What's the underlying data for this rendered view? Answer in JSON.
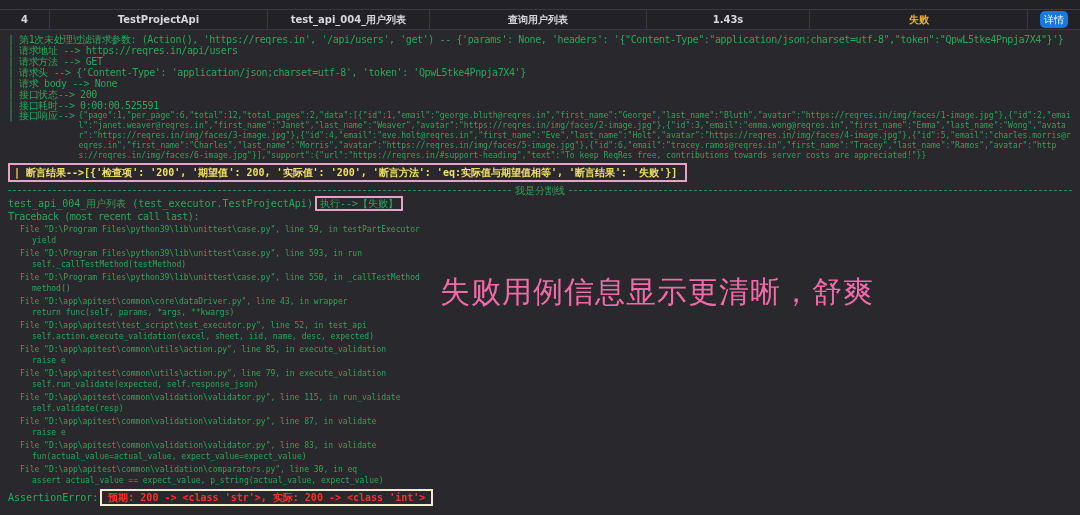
{
  "table": {
    "rows": [
      {
        "index": "4",
        "project": "TestProjectApi",
        "case": "test_api_004_用户列表",
        "description": "查询用户列表",
        "duration": "1.43s",
        "result": "失败",
        "color": "#f5b323",
        "action": "详情"
      }
    ]
  },
  "log": {
    "request_lines": [
      "| 第1次未处理过滤请求参数: (Action(), 'https://reqres.in', '/api/users', 'get') -- {'params': None, 'headers': '{\"Content-Type\":\"application/json;charset=utf-8\",\"token\":\"QpwL5tke4Pnpja7X4\"}'}",
      "| 请求地址 --> https://reqres.in/api/users",
      "| 请求方法 --> GET",
      "| 请求头 --> {'Content-Type': 'application/json;charset=utf-8', 'token': 'QpwL5tke4Pnpja7X4'}",
      "| 请求 body --> None",
      "| 接口状态--> 200",
      "| 接口耗时--> 0:00:00.525591"
    ],
    "response_label": "| 接口响应-->",
    "response_body": "{\"page\":1,\"per_page\":6,\"total\":12,\"total_pages\":2,\"data\":[{\"id\":1,\"email\":\"george.bluth@reqres.in\",\"first_name\":\"George\",\"last_name\":\"Bluth\",\"avatar\":\"https://reqres.in/img/faces/1-image.jpg\"},{\"id\":2,\"email\":\"janet.weaver@reqres.in\",\"first_name\":\"Janet\",\"last_name\":\"Weaver\",\"avatar\":\"https://reqres.in/img/faces/2-image.jpg\"},{\"id\":3,\"email\":\"emma.wong@reqres.in\",\"first_name\":\"Emma\",\"last_name\":\"Wong\",\"avatar\":\"https://reqres.in/img/faces/3-image.jpg\"},{\"id\":4,\"email\":\"eve.holt@reqres.in\",\"first_name\":\"Eve\",\"last_name\":\"Holt\",\"avatar\":\"https://reqres.in/img/faces/4-image.jpg\"},{\"id\":5,\"email\":\"charles.morris@reqres.in\",\"first_name\":\"Charles\",\"last_name\":\"Morris\",\"avatar\":\"https://reqres.in/img/faces/5-image.jpg\"},{\"id\":6,\"email\":\"tracey.ramos@reqres.in\",\"first_name\":\"Tracey\",\"last_name\":\"Ramos\",\"avatar\":\"https://reqres.in/img/faces/6-image.jpg\"}],\"support\":{\"url\":\"https://reqres.in/#support-heading\",\"text\":\"To keep ReqRes free, contributions towards server costs are appreciated!\"}}",
    "assertion_result": "| 断言结果-->[{'检查项': '200', '期望值': 200, '实际值': '200', '断言方法': 'eq:实际值与期望值相等', '断言结果': '失败'}]",
    "separator": "我是分割线",
    "test_name": "test_api_004_用户列表 (test_executor.TestProjectApi)",
    "test_status": "执行-->【失败】",
    "traceback_header": "Traceback (most recent call last):",
    "frames": [
      {
        "location": "File \"D:\\Program Files\\python39\\lib\\unittest\\case.py\", line 59, in testPartExecutor",
        "code": "yield"
      },
      {
        "location": "File \"D:\\Program Files\\python39\\lib\\unittest\\case.py\", line 593, in run",
        "code": "self._callTestMethod(testMethod)"
      },
      {
        "location": "File \"D:\\Program Files\\python39\\lib\\unittest\\case.py\", line 550, in _callTestMethod",
        "code": "method()"
      },
      {
        "location": "File \"D:\\app\\apitest\\common\\core\\dataDriver.py\", line 43, in wrapper",
        "code": "return func(self, params, *args, **kwargs)"
      },
      {
        "location": "File \"D:\\app\\apitest\\test_script\\test_executor.py\", line 52, in test_api",
        "code": "self.action.execute_validation(excel, sheet, iid, name, desc, expected)"
      },
      {
        "location": "File \"D:\\app\\apitest\\common\\utils\\action.py\", line 85, in execute_validation",
        "code": "raise e"
      },
      {
        "location": "File \"D:\\app\\apitest\\common\\utils\\action.py\", line 79, in execute_validation",
        "code": "self.run_validate(expected, self.response_json)"
      },
      {
        "location": "File \"D:\\app\\apitest\\common\\validation\\validator.py\", line 115, in run_validate",
        "code": "self.validate(resp)"
      },
      {
        "location": "File \"D:\\app\\apitest\\common\\validation\\validator.py\", line 87, in validate",
        "code": "raise e"
      },
      {
        "location": "File \"D:\\app\\apitest\\common\\validation\\validator.py\", line 83, in validate",
        "code": "fun(actual_value=actual_value, expect_value=expect_value)"
      },
      {
        "location": "File \"D:\\app\\apitest\\common\\validation\\comparators.py\", line 30, in eq",
        "code": "assert actual_value == expect_value, p_string(actual_value, expect_value)"
      }
    ],
    "error_label": "AssertionError:",
    "error_message": "预期: 200 -> <class 'str'>, 实际: 200 -> <class 'int'>"
  },
  "caption": "失败用例信息显示更清晰，舒爽"
}
